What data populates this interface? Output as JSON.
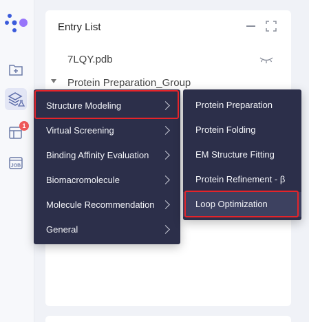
{
  "rail": {
    "icons": [
      "logo-icon",
      "folder-add-icon",
      "layers-flask-icon",
      "table-grid-icon",
      "job-icon"
    ],
    "badge_count": "1",
    "job_label": "JOB"
  },
  "panel": {
    "title": "Entry List",
    "entries": [
      {
        "label": "7LQY.pdb"
      },
      {
        "label": "Protein Preparation_Group"
      }
    ]
  },
  "menu": {
    "items": [
      {
        "label": "Structure Modeling",
        "highlighted": true
      },
      {
        "label": "Virtual Screening"
      },
      {
        "label": "Binding Affinity Evaluation"
      },
      {
        "label": "Biomacromolecule"
      },
      {
        "label": "Molecule Recommendation"
      },
      {
        "label": "General"
      }
    ]
  },
  "submenu": {
    "items": [
      {
        "label": "Protein Preparation"
      },
      {
        "label": "Protein Folding"
      },
      {
        "label": "EM Structure Fitting"
      },
      {
        "label": "Protein Refinement - β"
      },
      {
        "label": "Loop Optimization",
        "highlighted": true
      }
    ]
  },
  "colors": {
    "menu_bg": "#2c2f4a",
    "highlight_border": "#e5242a",
    "badge": "#ef5a5a",
    "logo_blue": "#3b5bdb",
    "logo_purple": "#9775fa"
  }
}
